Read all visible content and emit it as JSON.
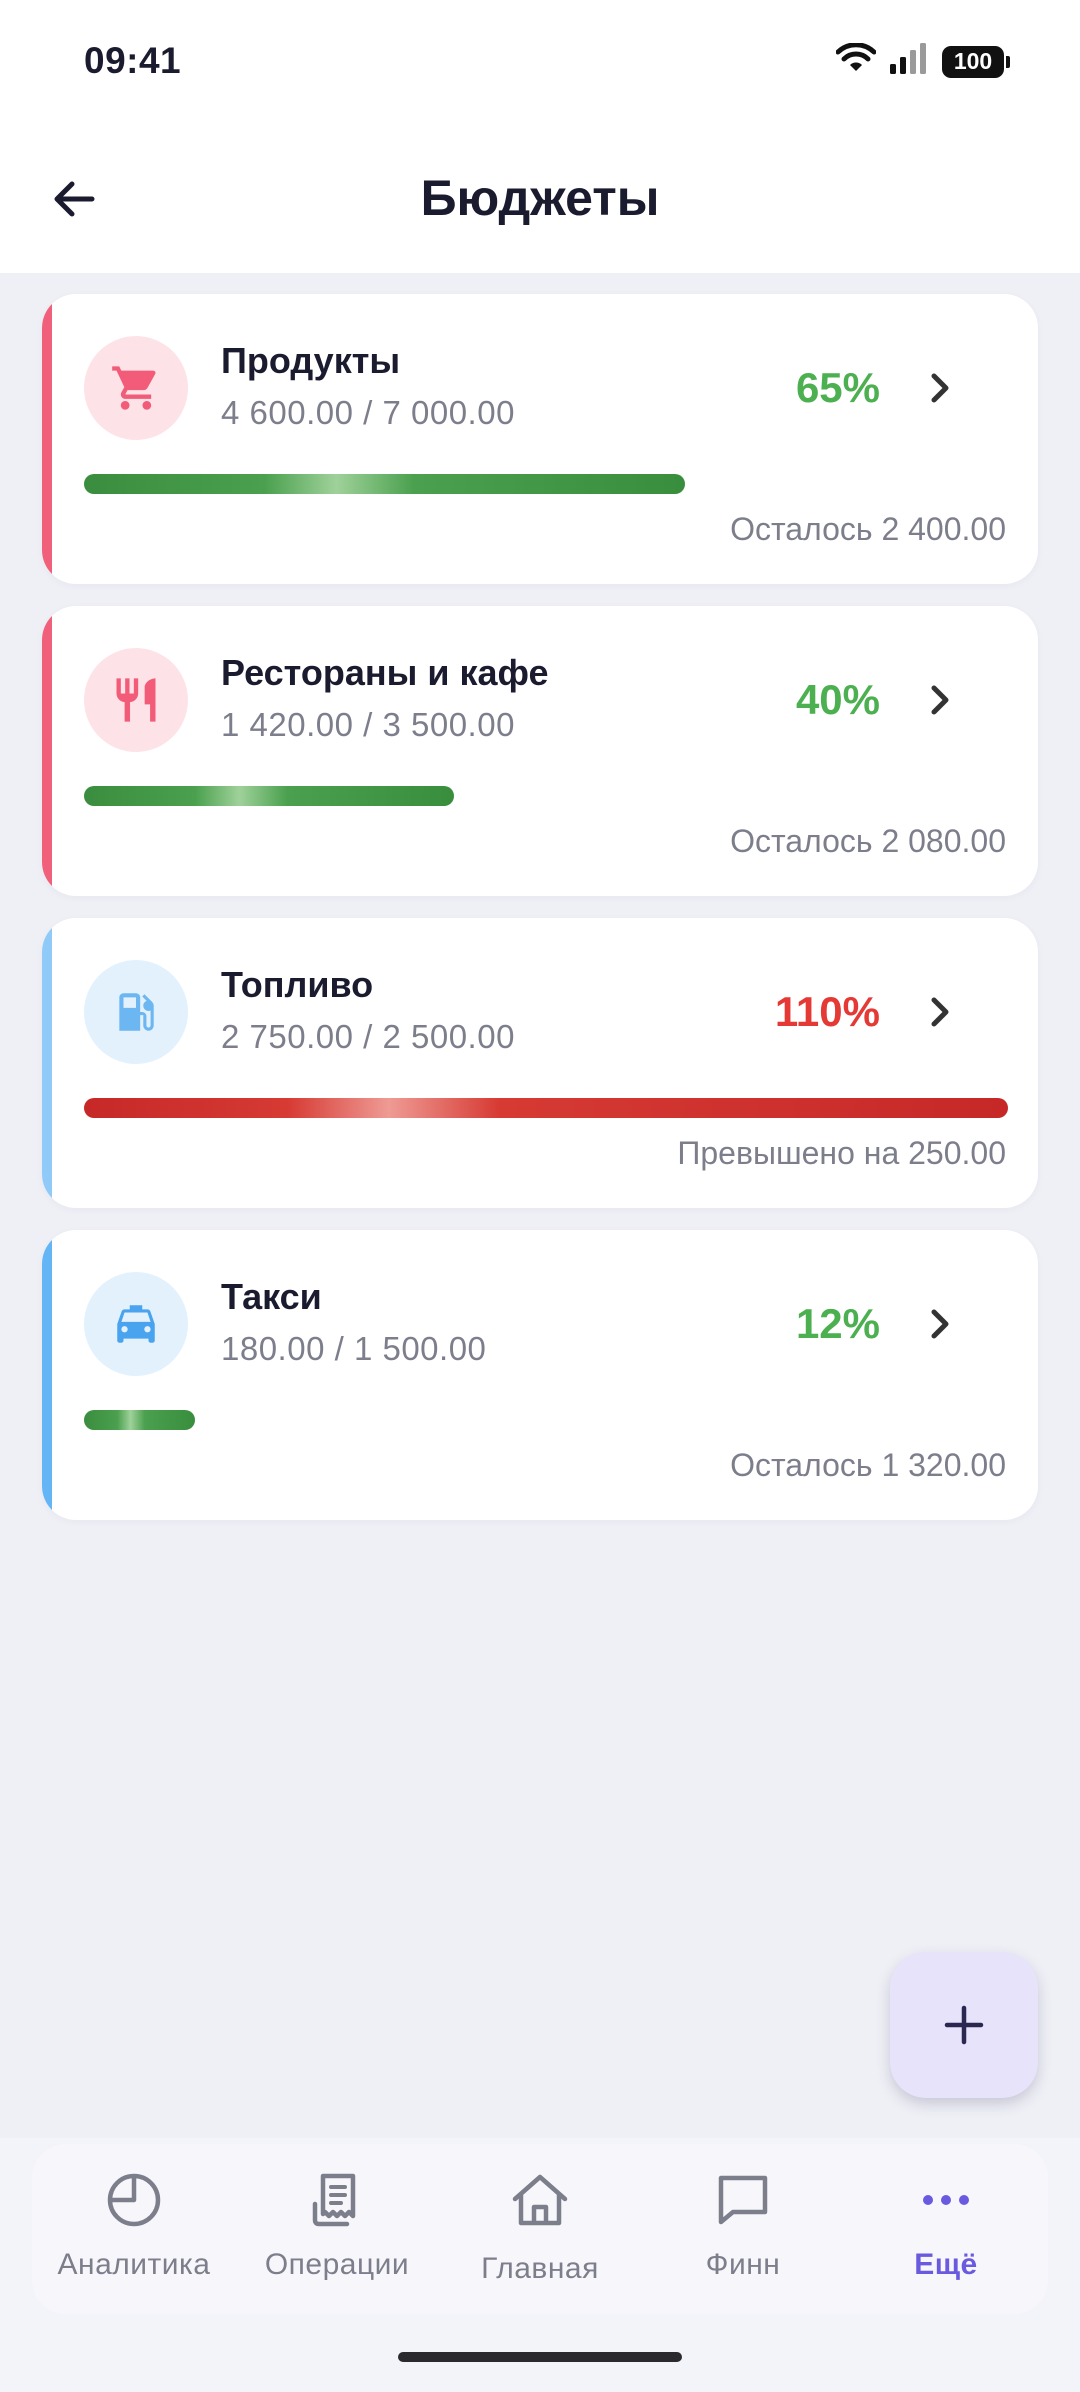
{
  "status_bar": {
    "time": "09:41",
    "battery": "100"
  },
  "header": {
    "title": "Бюджеты"
  },
  "budgets": [
    {
      "name": "Продукты",
      "amounts": "4 600.00 / 7 000.00",
      "percent": "65%",
      "progress": 0.65,
      "remaining": "Осталось 2 400.00",
      "icon": "cart-icon",
      "accent": "#f0607a",
      "icon_bg": "#fde3e8",
      "icon_color": "#f25c78",
      "status": "ok"
    },
    {
      "name": "Рестораны и кафе",
      "amounts": "1 420.00 / 3 500.00",
      "percent": "40%",
      "progress": 0.4,
      "remaining": "Осталось 2 080.00",
      "icon": "fork-knife-icon",
      "accent": "#f0607a",
      "icon_bg": "#fde3e8",
      "icon_color": "#f25c78",
      "status": "ok"
    },
    {
      "name": "Топливо",
      "amounts": "2 750.00 / 2 500.00",
      "percent": "110%",
      "progress": 1.1,
      "remaining": "Превышено на 250.00",
      "icon": "fuel-icon",
      "accent": "#90caf9",
      "icon_bg": "#e3f1fd",
      "icon_color": "#6cb6f2",
      "status": "over"
    },
    {
      "name": "Такси",
      "amounts": "180.00 / 1 500.00",
      "percent": "12%",
      "progress": 0.12,
      "remaining": "Осталось 1 320.00",
      "icon": "taxi-icon",
      "accent": "#64b5f6",
      "icon_bg": "#e3f1fd",
      "icon_color": "#4aa3ee",
      "status": "ok"
    }
  ],
  "fab": {
    "icon": "plus-icon"
  },
  "tabbar": {
    "items": [
      {
        "label": "Аналитика",
        "icon": "pie-chart-icon",
        "active": false
      },
      {
        "label": "Операции",
        "icon": "receipt-icon",
        "active": false
      },
      {
        "label": "Главная",
        "icon": "home-icon",
        "active": false
      },
      {
        "label": "Финн",
        "icon": "chat-icon",
        "active": false
      },
      {
        "label": "Ещё",
        "icon": "more-dots-icon",
        "active": true
      }
    ]
  },
  "colors": {
    "accent_purple": "#6a5ae0",
    "ok_green": "#4caf50",
    "over_red": "#e53935"
  }
}
